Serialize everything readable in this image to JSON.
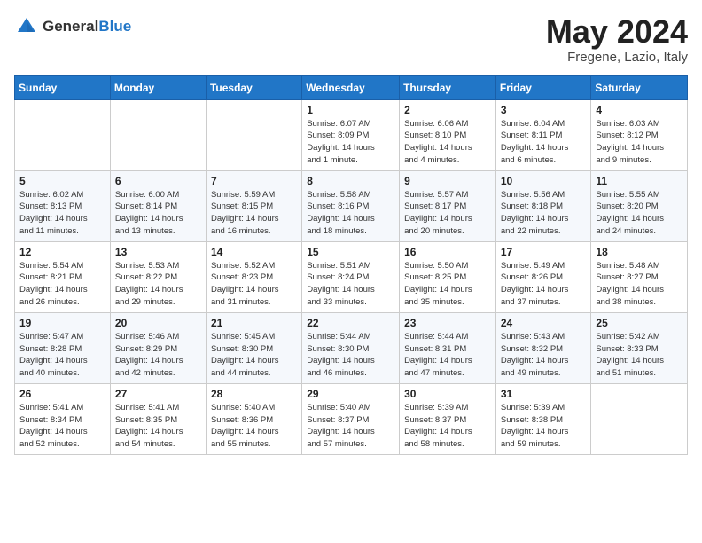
{
  "logo": {
    "text_general": "General",
    "text_blue": "Blue"
  },
  "title": "May 2024",
  "location": "Fregene, Lazio, Italy",
  "days_of_week": [
    "Sunday",
    "Monday",
    "Tuesday",
    "Wednesday",
    "Thursday",
    "Friday",
    "Saturday"
  ],
  "weeks": [
    [
      {
        "day": "",
        "info": ""
      },
      {
        "day": "",
        "info": ""
      },
      {
        "day": "",
        "info": ""
      },
      {
        "day": "1",
        "info": "Sunrise: 6:07 AM\nSunset: 8:09 PM\nDaylight: 14 hours\nand 1 minute."
      },
      {
        "day": "2",
        "info": "Sunrise: 6:06 AM\nSunset: 8:10 PM\nDaylight: 14 hours\nand 4 minutes."
      },
      {
        "day": "3",
        "info": "Sunrise: 6:04 AM\nSunset: 8:11 PM\nDaylight: 14 hours\nand 6 minutes."
      },
      {
        "day": "4",
        "info": "Sunrise: 6:03 AM\nSunset: 8:12 PM\nDaylight: 14 hours\nand 9 minutes."
      }
    ],
    [
      {
        "day": "5",
        "info": "Sunrise: 6:02 AM\nSunset: 8:13 PM\nDaylight: 14 hours\nand 11 minutes."
      },
      {
        "day": "6",
        "info": "Sunrise: 6:00 AM\nSunset: 8:14 PM\nDaylight: 14 hours\nand 13 minutes."
      },
      {
        "day": "7",
        "info": "Sunrise: 5:59 AM\nSunset: 8:15 PM\nDaylight: 14 hours\nand 16 minutes."
      },
      {
        "day": "8",
        "info": "Sunrise: 5:58 AM\nSunset: 8:16 PM\nDaylight: 14 hours\nand 18 minutes."
      },
      {
        "day": "9",
        "info": "Sunrise: 5:57 AM\nSunset: 8:17 PM\nDaylight: 14 hours\nand 20 minutes."
      },
      {
        "day": "10",
        "info": "Sunrise: 5:56 AM\nSunset: 8:18 PM\nDaylight: 14 hours\nand 22 minutes."
      },
      {
        "day": "11",
        "info": "Sunrise: 5:55 AM\nSunset: 8:20 PM\nDaylight: 14 hours\nand 24 minutes."
      }
    ],
    [
      {
        "day": "12",
        "info": "Sunrise: 5:54 AM\nSunset: 8:21 PM\nDaylight: 14 hours\nand 26 minutes."
      },
      {
        "day": "13",
        "info": "Sunrise: 5:53 AM\nSunset: 8:22 PM\nDaylight: 14 hours\nand 29 minutes."
      },
      {
        "day": "14",
        "info": "Sunrise: 5:52 AM\nSunset: 8:23 PM\nDaylight: 14 hours\nand 31 minutes."
      },
      {
        "day": "15",
        "info": "Sunrise: 5:51 AM\nSunset: 8:24 PM\nDaylight: 14 hours\nand 33 minutes."
      },
      {
        "day": "16",
        "info": "Sunrise: 5:50 AM\nSunset: 8:25 PM\nDaylight: 14 hours\nand 35 minutes."
      },
      {
        "day": "17",
        "info": "Sunrise: 5:49 AM\nSunset: 8:26 PM\nDaylight: 14 hours\nand 37 minutes."
      },
      {
        "day": "18",
        "info": "Sunrise: 5:48 AM\nSunset: 8:27 PM\nDaylight: 14 hours\nand 38 minutes."
      }
    ],
    [
      {
        "day": "19",
        "info": "Sunrise: 5:47 AM\nSunset: 8:28 PM\nDaylight: 14 hours\nand 40 minutes."
      },
      {
        "day": "20",
        "info": "Sunrise: 5:46 AM\nSunset: 8:29 PM\nDaylight: 14 hours\nand 42 minutes."
      },
      {
        "day": "21",
        "info": "Sunrise: 5:45 AM\nSunset: 8:30 PM\nDaylight: 14 hours\nand 44 minutes."
      },
      {
        "day": "22",
        "info": "Sunrise: 5:44 AM\nSunset: 8:30 PM\nDaylight: 14 hours\nand 46 minutes."
      },
      {
        "day": "23",
        "info": "Sunrise: 5:44 AM\nSunset: 8:31 PM\nDaylight: 14 hours\nand 47 minutes."
      },
      {
        "day": "24",
        "info": "Sunrise: 5:43 AM\nSunset: 8:32 PM\nDaylight: 14 hours\nand 49 minutes."
      },
      {
        "day": "25",
        "info": "Sunrise: 5:42 AM\nSunset: 8:33 PM\nDaylight: 14 hours\nand 51 minutes."
      }
    ],
    [
      {
        "day": "26",
        "info": "Sunrise: 5:41 AM\nSunset: 8:34 PM\nDaylight: 14 hours\nand 52 minutes."
      },
      {
        "day": "27",
        "info": "Sunrise: 5:41 AM\nSunset: 8:35 PM\nDaylight: 14 hours\nand 54 minutes."
      },
      {
        "day": "28",
        "info": "Sunrise: 5:40 AM\nSunset: 8:36 PM\nDaylight: 14 hours\nand 55 minutes."
      },
      {
        "day": "29",
        "info": "Sunrise: 5:40 AM\nSunset: 8:37 PM\nDaylight: 14 hours\nand 57 minutes."
      },
      {
        "day": "30",
        "info": "Sunrise: 5:39 AM\nSunset: 8:37 PM\nDaylight: 14 hours\nand 58 minutes."
      },
      {
        "day": "31",
        "info": "Sunrise: 5:39 AM\nSunset: 8:38 PM\nDaylight: 14 hours\nand 59 minutes."
      },
      {
        "day": "",
        "info": ""
      }
    ]
  ]
}
